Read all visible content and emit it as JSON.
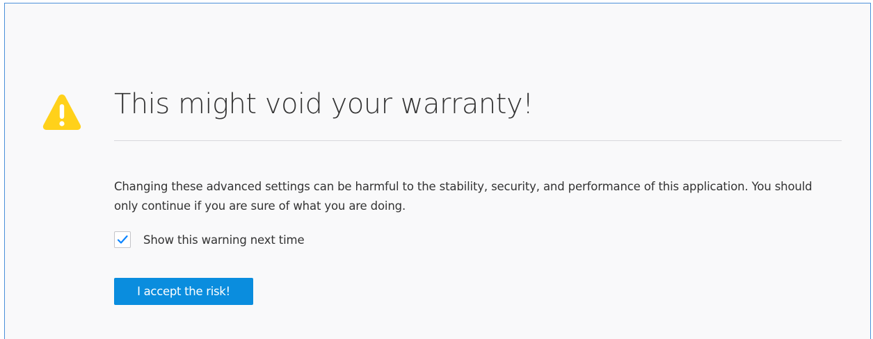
{
  "warning": {
    "icon": "warning-triangle-icon",
    "icon_color": "#ffd11a",
    "title": "This might void your warranty!",
    "description": "Changing these advanced settings can be harmful to the stability, security, and performance of this application. You should only continue if you are sure of what you are doing."
  },
  "checkbox": {
    "label": "Show this warning next time",
    "checked": true,
    "check_color": "#0a84ff"
  },
  "accept_button": {
    "label": "I accept the risk!",
    "color": "#0a8dde"
  }
}
